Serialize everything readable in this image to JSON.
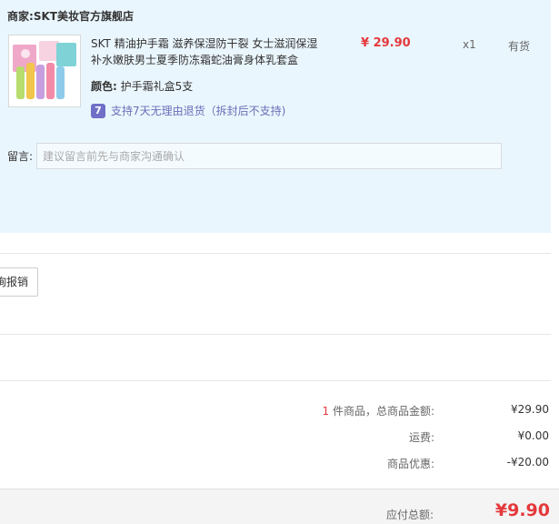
{
  "store": {
    "label": "商家:",
    "name": "SKT美妆官方旗舰店"
  },
  "product": {
    "title": "SKT 精油护手霜 滋养保湿防干裂 女士滋润保湿补水嫩肤男士夏季防冻霜蛇油膏身体乳套盒",
    "price": "¥ 29.90",
    "quantity": "x1",
    "stock": "有货",
    "attr_label": "颜色:",
    "attr_value": "护手霜礼盒5支",
    "return_badge": "7",
    "return_policy": "支持7天无理由退货（拆封后不支持)"
  },
  "message": {
    "label": "留言:",
    "placeholder": "建议留言前先与商家沟通确认"
  },
  "invoice": {
    "button_label": "询报销"
  },
  "summary": {
    "count": "1",
    "items_label": " 件商品，总商品金额:",
    "items_value": "¥29.90",
    "shipping_label": "运费:",
    "shipping_value": "¥0.00",
    "discount_label": "商品优惠:",
    "discount_value": "-¥20.00",
    "total_label": "应付总额:",
    "total_value": "¥9.90"
  },
  "colors": {
    "accent_red": "#e4393c",
    "store_panel_bg": "#eaf6fd",
    "return_badge": "#6f6fc7"
  }
}
